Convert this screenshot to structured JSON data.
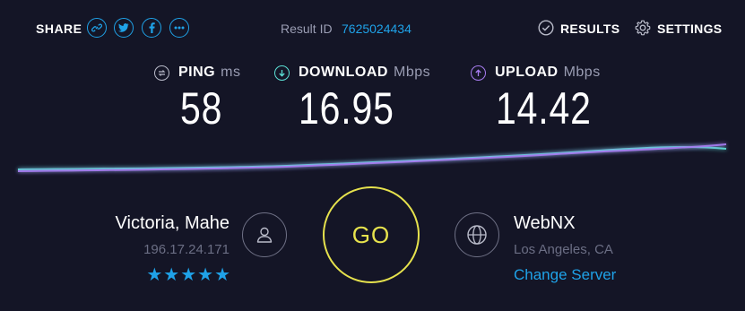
{
  "header": {
    "share_label": "SHARE",
    "share_icons": [
      "link-icon",
      "twitter-icon",
      "facebook-icon",
      "more-icon"
    ],
    "result_label": "Result ID",
    "result_id": "7625024434",
    "results_label": "RESULTS",
    "settings_label": "SETTINGS"
  },
  "metrics": {
    "ping": {
      "label": "PING",
      "unit": "ms",
      "value": "58",
      "icon": "ping-icon"
    },
    "download": {
      "label": "DOWNLOAD",
      "unit": "Mbps",
      "value": "16.95",
      "icon": "download-icon"
    },
    "upload": {
      "label": "UPLOAD",
      "unit": "Mbps",
      "value": "14.42",
      "icon": "upload-icon"
    }
  },
  "colors": {
    "background": "#141526",
    "accent_blue": "#1fa2e8",
    "download_cyan": "#5ce1d6",
    "upload_purple": "#a77cf0",
    "go_yellow": "#e6e24d"
  },
  "isp": {
    "name": "Victoria, Mahe",
    "ip": "196.17.24.171",
    "stars": "★★★★★",
    "rating": 5
  },
  "go_label": "GO",
  "server": {
    "name": "WebNX",
    "location": "Los Angeles, CA",
    "change_label": "Change Server"
  }
}
